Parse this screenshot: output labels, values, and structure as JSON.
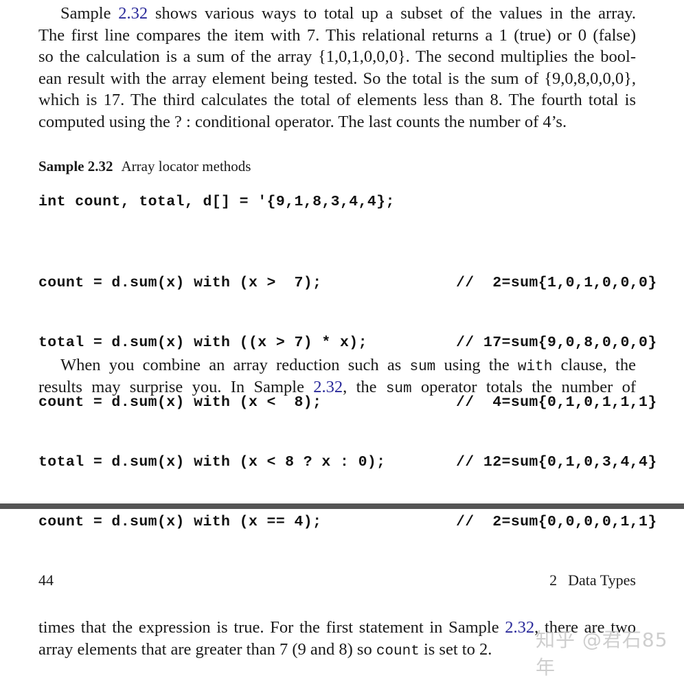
{
  "para1": {
    "lines": [
      {
        "before": "Sample ",
        "link": "2.32",
        "after": " shows various ways to total up a subset of the values in the array."
      },
      {
        "text": "The first line compares the item with 7. This relational returns a 1 (true) or 0 (false)"
      },
      {
        "text": "so the calculation is a sum of the array {1,0,1,0,0,0}. The second multiplies the bool-"
      },
      {
        "text": "ean result with the array element being tested. So the total is the sum of {9,0,8,0,0,0},"
      },
      {
        "text": "which is 17. The third calculates the total of elements less than 8. The fourth total is"
      },
      {
        "text": "computed using the ? : conditional operator. The last counts the number of 4’s."
      }
    ]
  },
  "caption": {
    "number": "Sample 2.32",
    "title": "Array locator methods"
  },
  "code": {
    "declaration": "int count, total, d[] = '{9,1,8,3,4,4};",
    "lines": [
      {
        "stmt": "count = d.sum(x) with (x >  7);",
        "comment": "//  2=sum{1,0,1,0,0,0}"
      },
      {
        "stmt": "total = d.sum(x) with ((x > 7) * x);",
        "comment": "// 17=sum{9,0,8,0,0,0}"
      },
      {
        "stmt": "count = d.sum(x) with (x <  8);",
        "comment": "//  4=sum{0,1,0,1,1,1}"
      },
      {
        "stmt": "total = d.sum(x) with (x < 8 ? x : 0);",
        "comment": "// 12=sum{0,1,0,3,4,4}"
      },
      {
        "stmt": "count = d.sum(x) with (x == 4);",
        "comment": "//  2=sum{0,0,0,0,1,1}"
      }
    ]
  },
  "para2": {
    "line1": {
      "a": "When you combine an array reduction such as ",
      "code1": "sum",
      "b": " using the ",
      "code2": "with",
      "c": " clause, the"
    },
    "line2": {
      "a": "results may surprise you. In Sample ",
      "link": "2.32",
      "b": ", the ",
      "code": "sum",
      "c": " operator totals the number of"
    }
  },
  "footer": {
    "page_number": "44",
    "chapter_number": "2",
    "chapter_title": "Data Types"
  },
  "para3": {
    "line1": {
      "a": "times that the expression is true. For the first statement in Sample ",
      "link": "2.32",
      "b": ", there are two"
    },
    "line2": {
      "a": "array elements that are greater than 7 (9 and 8) so ",
      "code": "count",
      "b": " is set to 2."
    }
  },
  "watermark": "知乎 @君石85年",
  "colors": {
    "link": "#2a2a9a",
    "divider": "#555555",
    "text": "#1a1a1a"
  }
}
